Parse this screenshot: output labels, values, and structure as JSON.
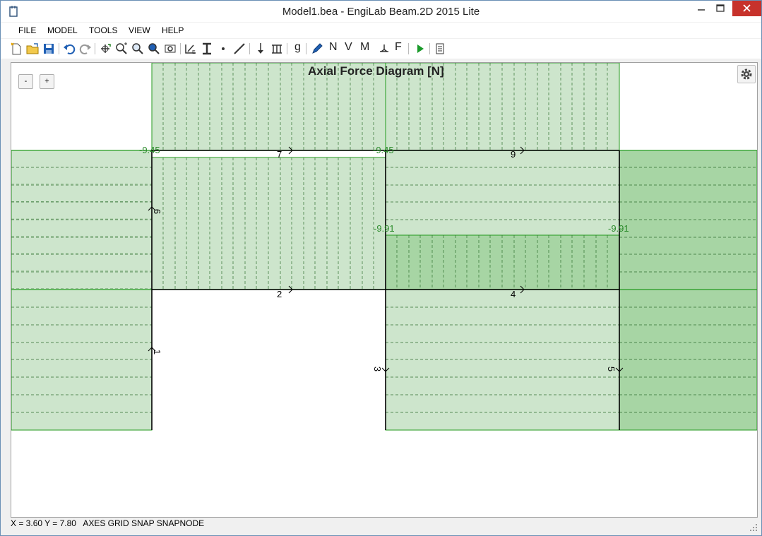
{
  "window": {
    "title": "Model1.bea - EngiLab Beam.2D 2015 Lite"
  },
  "menu": [
    "FILE",
    "MODEL",
    "TOOLS",
    "VIEW",
    "HELP"
  ],
  "toolbar": {
    "text_buttons": {
      "g": "g",
      "n": "N",
      "v": "V",
      "m": "M",
      "f": "F"
    }
  },
  "canvas": {
    "zoom_out_label": "-",
    "zoom_in_label": "+",
    "title": "Axial Force Diagram [N]",
    "value_labels": {
      "left_top": "-9.45",
      "mid_top": "-9.45",
      "mid_lower": "-9.91",
      "right_lower": "-9.91"
    },
    "element_labels": {
      "e7": "7",
      "e9": "9",
      "e2": "2",
      "e4": "4",
      "e6": "6",
      "e1": "1",
      "e3": "3",
      "e5": "5"
    }
  },
  "status_bar": {
    "coords": "X = 3.60  Y = 7.80",
    "flags": "AXES  GRID  SNAP  SNAPNODE"
  },
  "colors": {
    "fill_light": "#cde5cc",
    "fill_dark": "#a7d5a4",
    "stroke_green": "#239a1e",
    "label_green": "#2a8a2a",
    "beam": "#000000"
  }
}
